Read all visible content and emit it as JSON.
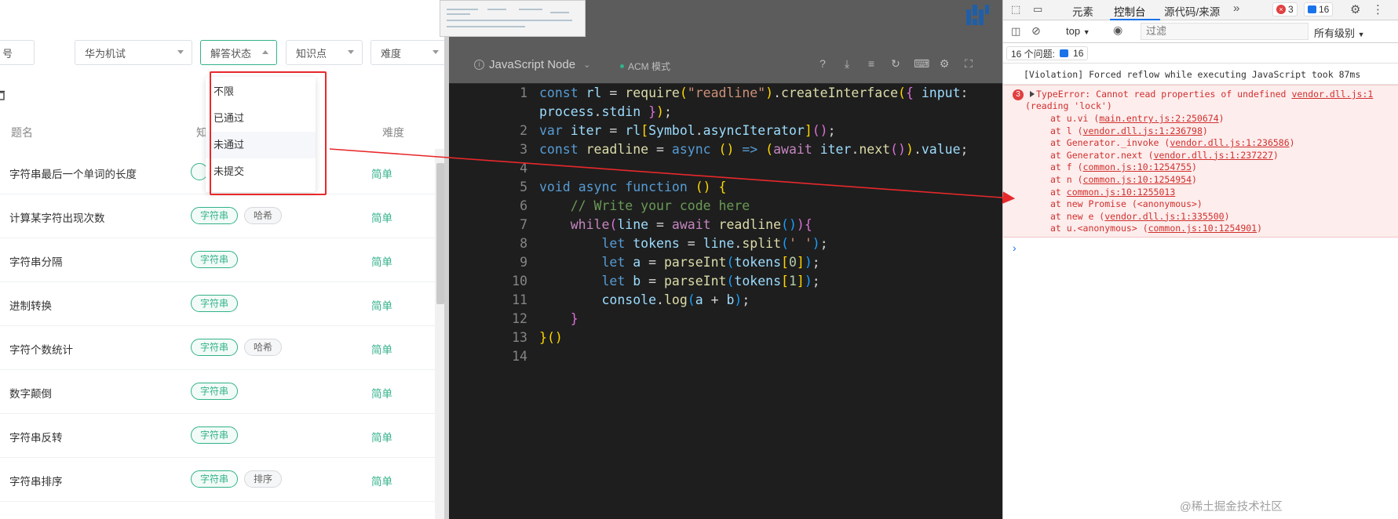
{
  "filters": {
    "number": "号",
    "company": "华为机试",
    "status": "解答状态",
    "topic": "知识点",
    "difficulty": "难度"
  },
  "table": {
    "header_title": "题名",
    "header_tag": "知",
    "header_difficulty": "难度",
    "rows": [
      {
        "title": "字符串最后一个单词的长度",
        "tags": [
          ""
        ],
        "difficulty": "简单"
      },
      {
        "title": "计算某字符出现次数",
        "tags": [
          "字符串",
          "哈希"
        ],
        "difficulty": "简单"
      },
      {
        "title": "字符串分隔",
        "tags": [
          "字符串"
        ],
        "difficulty": "简单"
      },
      {
        "title": "进制转换",
        "tags": [
          "字符串"
        ],
        "difficulty": "简单"
      },
      {
        "title": "字符个数统计",
        "tags": [
          "字符串",
          "哈希"
        ],
        "difficulty": "简单"
      },
      {
        "title": "数字颠倒",
        "tags": [
          "字符串"
        ],
        "difficulty": "简单"
      },
      {
        "title": "字符串反转",
        "tags": [
          "字符串"
        ],
        "difficulty": "简单"
      },
      {
        "title": "字符串排序",
        "tags": [
          "字符串",
          "排序"
        ],
        "difficulty": "简单"
      }
    ]
  },
  "status_dropdown": {
    "options": [
      "不限",
      "已通过",
      "未通过",
      "未提交"
    ],
    "highlighted": "未通过"
  },
  "editor": {
    "language": "JavaScript Node",
    "mode": "ACM 模式",
    "line_numbers": [
      "1",
      "",
      "2",
      "3",
      "4",
      "5",
      "6",
      "7",
      "8",
      "9",
      "10",
      "11",
      "12",
      "13",
      "14"
    ]
  },
  "devtools": {
    "tabs": [
      "元素",
      "控制台",
      "源代码/来源"
    ],
    "active_tab": "控制台",
    "error_count": "3",
    "message_count": "16",
    "context": "top",
    "filter_placeholder": "过滤",
    "levels": "所有级别",
    "issues_label": "16 个问题:",
    "issues_count": "16",
    "violation": "[Violation] Forced reflow while executing JavaScript took 87ms",
    "error_count_badge": "3",
    "error_line1": "TypeError: Cannot read properties of undefined",
    "error_line1_link": "vendor.dll.js:1",
    "error_line2": "(reading 'lock')",
    "stack": [
      {
        "prefix": "at u.vi (",
        "link": "main.entry.js:2:250674",
        "suffix": ")"
      },
      {
        "prefix": "at l (",
        "link": "vendor.dll.js:1:236798",
        "suffix": ")"
      },
      {
        "prefix": "at Generator._invoke (",
        "link": "vendor.dll.js:1:236586",
        "suffix": ")"
      },
      {
        "prefix": "at Generator.next (",
        "link": "vendor.dll.js:1:237227",
        "suffix": ")"
      },
      {
        "prefix": "at f (",
        "link": "common.js:10:1254755",
        "suffix": ")"
      },
      {
        "prefix": "at n (",
        "link": "common.js:10:1254954",
        "suffix": ")"
      },
      {
        "prefix": "at ",
        "link": "common.js:10:1255013",
        "suffix": ""
      },
      {
        "prefix": "at new Promise (<anonymous>)",
        "link": "",
        "suffix": ""
      },
      {
        "prefix": "at new e (",
        "link": "vendor.dll.js:1:335500",
        "suffix": ")"
      },
      {
        "prefix": "at u.<anonymous> (",
        "link": "common.js:10:1254901",
        "suffix": ")"
      }
    ],
    "prompt": "›"
  },
  "watermark": "@稀土掘金技术社区",
  "colors": {
    "accent_green": "#32b18a",
    "highlight_red": "#e8282b",
    "error_red": "#d0302d"
  }
}
